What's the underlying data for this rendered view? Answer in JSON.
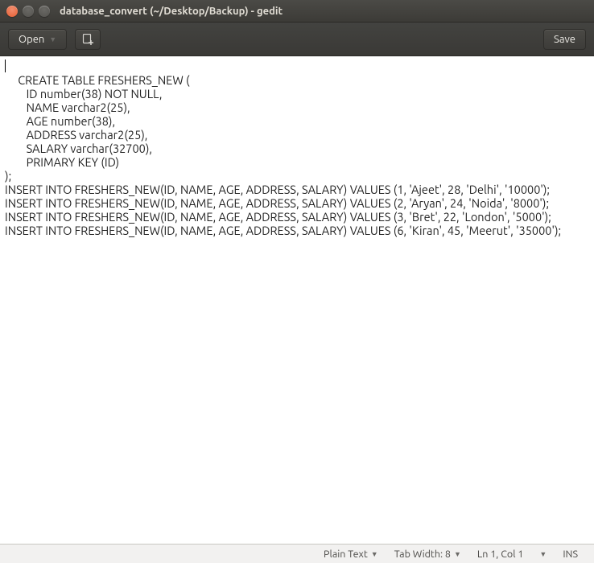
{
  "titlebar": {
    "title": "database_convert (~/Desktop/Backup) - gedit"
  },
  "toolbar": {
    "open_label": "Open",
    "save_label": "Save"
  },
  "editor": {
    "content": "CREATE TABLE FRESHERS_NEW (\n        ID number(38) NOT NULL,\n        NAME varchar2(25),\n        AGE number(38),\n        ADDRESS varchar2(25),\n        SALARY varchar(32700),\n        PRIMARY KEY (ID)\n);\nINSERT INTO FRESHERS_NEW(ID, NAME, AGE, ADDRESS, SALARY) VALUES (1, 'Ajeet', 28, 'Delhi', '10000');\nINSERT INTO FRESHERS_NEW(ID, NAME, AGE, ADDRESS, SALARY) VALUES (2, 'Aryan', 24, 'Noida', '8000');\nINSERT INTO FRESHERS_NEW(ID, NAME, AGE, ADDRESS, SALARY) VALUES (3, 'Bret', 22, 'London', '5000');\nINSERT INTO FRESHERS_NEW(ID, NAME, AGE, ADDRESS, SALARY) VALUES (6, 'Kiran', 45, 'Meerut', '35000');"
  },
  "statusbar": {
    "language": "Plain Text",
    "tab_width_label": "Tab Width: 8",
    "cursor": "Ln 1, Col 1",
    "insert_mode": "INS"
  }
}
